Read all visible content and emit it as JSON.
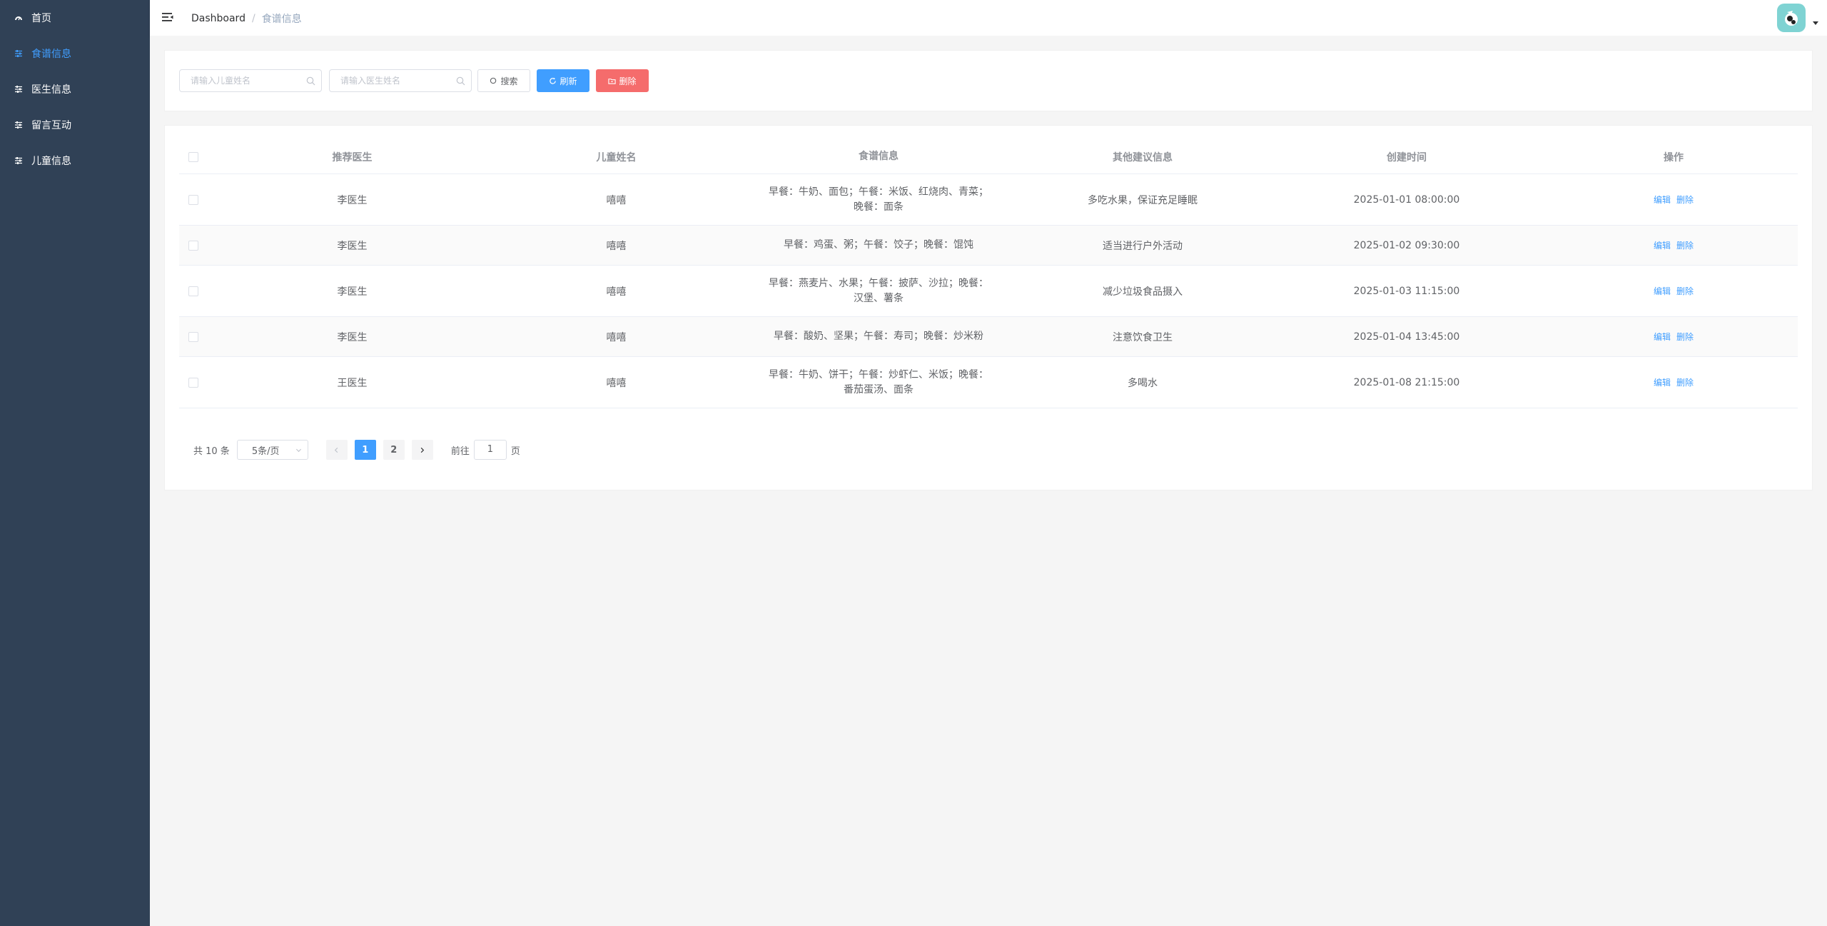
{
  "sidebar": {
    "items": [
      {
        "label": "首页",
        "icon": "dashboard-icon",
        "active": false
      },
      {
        "label": "食谱信息",
        "icon": "sliders-icon",
        "active": true
      },
      {
        "label": "医生信息",
        "icon": "sliders-icon",
        "active": false
      },
      {
        "label": "留言互动",
        "icon": "sliders-icon",
        "active": false
      },
      {
        "label": "儿童信息",
        "icon": "sliders-icon",
        "active": false
      }
    ]
  },
  "header": {
    "breadcrumb": {
      "home": "Dashboard",
      "separator": "/",
      "current": "食谱信息"
    }
  },
  "search": {
    "child_placeholder": "请输入儿童姓名",
    "doctor_placeholder": "请输入医生姓名",
    "search_label": "搜索",
    "refresh_label": "刷新",
    "delete_label": "删除"
  },
  "table": {
    "columns": [
      "推荐医生",
      "儿童姓名",
      "食谱信息",
      "其他建议信息",
      "创建时间",
      "操作"
    ],
    "rows": [
      {
        "doctor": "李医生",
        "child": "嘻嘻",
        "diet": "早餐：牛奶、面包；午餐：米饭、红烧肉、青菜；晚餐：面条",
        "advice": "多吃水果，保证充足睡眠",
        "time": "2025-01-01 08:00:00",
        "edit": "编辑",
        "delete": "删除"
      },
      {
        "doctor": "李医生",
        "child": "嘻嘻",
        "diet": "早餐：鸡蛋、粥；午餐：饺子；晚餐：馄饨",
        "advice": "适当进行户外活动",
        "time": "2025-01-02 09:30:00",
        "edit": "编辑",
        "delete": "删除"
      },
      {
        "doctor": "李医生",
        "child": "嘻嘻",
        "diet": "早餐：燕麦片、水果；午餐：披萨、沙拉；晚餐：汉堡、薯条",
        "advice": "减少垃圾食品摄入",
        "time": "2025-01-03 11:15:00",
        "edit": "编辑",
        "delete": "删除"
      },
      {
        "doctor": "李医生",
        "child": "嘻嘻",
        "diet": "早餐：酸奶、坚果；午餐：寿司；晚餐：炒米粉",
        "advice": "注意饮食卫生",
        "time": "2025-01-04 13:45:00",
        "edit": "编辑",
        "delete": "删除"
      },
      {
        "doctor": "王医生",
        "child": "嘻嘻",
        "diet": "早餐：牛奶、饼干；午餐：炒虾仁、米饭；晚餐：番茄蛋汤、面条",
        "advice": "多喝水",
        "time": "2025-01-08 21:15:00",
        "edit": "编辑",
        "delete": "删除"
      }
    ]
  },
  "pagination": {
    "total": "共 10 条",
    "page_size": "5条/页",
    "pages": [
      "1",
      "2"
    ],
    "current_page": "1",
    "goto_label": "前往",
    "goto_value": "1",
    "page_unit": "页"
  },
  "colors": {
    "sidebar_bg": "#304156",
    "primary": "#409eff",
    "danger": "#f56c6c",
    "avatar_bg": "#7fd3d3"
  }
}
